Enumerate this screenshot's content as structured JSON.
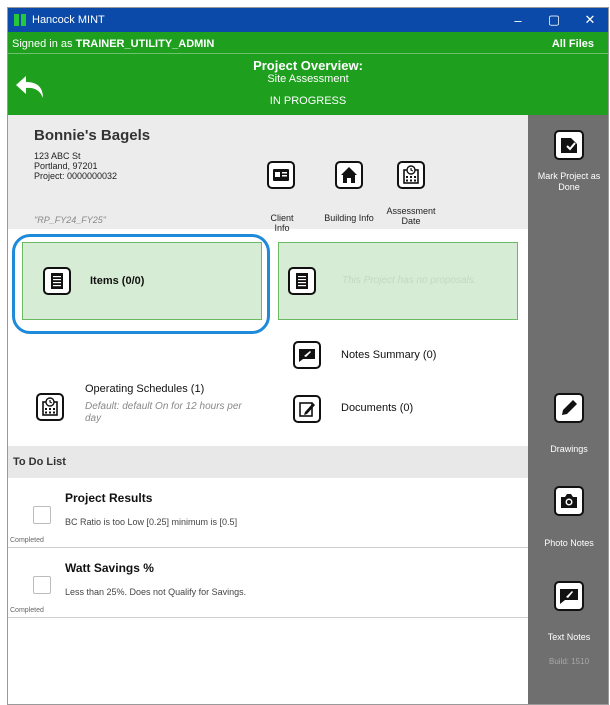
{
  "window": {
    "title": "Hancock MINT",
    "controls": [
      "–",
      "▢",
      "✕"
    ]
  },
  "header": {
    "signed_in_prefix": "Signed in as ",
    "signed_in_user": "TRAINER_UTILITY_ADMIN",
    "all_files": "All Files",
    "page_title": "Project Overview:",
    "page_subtitle": "Site Assessment",
    "status": "IN PROGRESS"
  },
  "project": {
    "name": "Bonnie's Bagels",
    "street": "123 ABC St",
    "city": "Portland, 97201",
    "project_number": "Project: 0000000032",
    "tag": "\"RP_FY24_FY25\""
  },
  "top_actions": {
    "client_info": "Client Info",
    "building_info": "Building Info",
    "assessment_date_1": "Assessment",
    "assessment_date_2": "Date"
  },
  "cards": {
    "items": "Items (0/0)",
    "proposals_empty": "This Project has no proposals."
  },
  "rows": {
    "notes_summary": "Notes Summary (0)",
    "operating_schedules": "Operating Schedules (1)",
    "operating_default_1": "Default: default On for 12 hours per",
    "operating_default_2": "day",
    "documents": "Documents (0)"
  },
  "todo": {
    "heading": "To Do List",
    "items": [
      {
        "title": "Project Results",
        "desc": "BC Ratio is too Low [0.25] minimum is [0.5]",
        "status": "Completed"
      },
      {
        "title": "Watt Savings %",
        "desc": "Less than 25%. Does not Qualify for Savings.",
        "status": "Completed"
      }
    ]
  },
  "sidebar": {
    "mark_done_1": "Mark Project as",
    "mark_done_2": "Done",
    "drawings": "Drawings",
    "photo_notes": "Photo Notes",
    "text_notes": "Text Notes",
    "build": "Build: 1510"
  },
  "colors": {
    "titlebar": "#0b4aa8",
    "header": "#1ea01e",
    "card": "#d7ecd4",
    "highlight": "#1e8ad9",
    "sidebar": "#6f6f6f"
  }
}
